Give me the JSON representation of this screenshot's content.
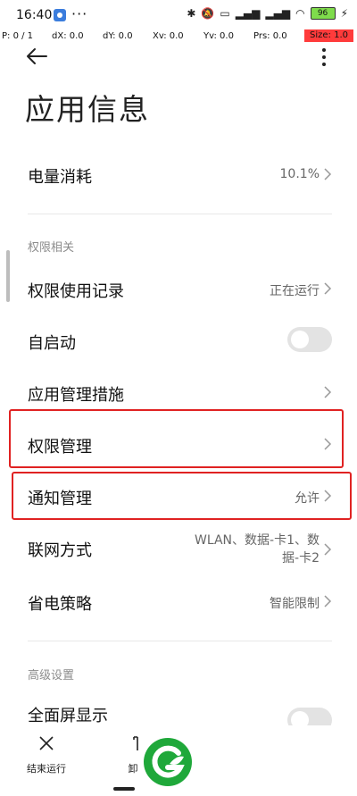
{
  "status_bar": {
    "time": "16:40",
    "more": "···",
    "battery": "96",
    "icons": [
      "bluetooth-icon",
      "mute-icon",
      "laptop-icon",
      "signal-icon",
      "signal-icon",
      "wifi-icon",
      "battery-icon",
      "charging-icon"
    ]
  },
  "debug": {
    "p": "P: 0 / 1",
    "dx": "dX: 0.0",
    "dy": "dY: 0.0",
    "xv": "Xv: 0.0",
    "yv": "Yv: 0.0",
    "prs": "Prs: 0.0",
    "size": "Size: 1.0"
  },
  "header": {
    "title": "应用信息"
  },
  "rows": {
    "battery": {
      "label": "电量消耗",
      "value": "10.1%"
    },
    "permission_records": {
      "label": "权限使用记录",
      "value": "正在运行"
    },
    "autostart": {
      "label": "自启动",
      "enabled": false
    },
    "app_management": {
      "label": "应用管理措施"
    },
    "permission_management": {
      "label": "权限管理"
    },
    "notification_management": {
      "label": "通知管理",
      "value": "允许"
    },
    "network_mode": {
      "label": "联网方式",
      "value_line1": "WLAN、数据-卡1、数",
      "value_line2": "据-卡2"
    },
    "power_saving": {
      "label": "省电策略",
      "value": "智能限制"
    },
    "fullscreen": {
      "label": "全面屏显示",
      "enabled": false
    }
  },
  "sections": {
    "permissions": "权限相关",
    "advanced": "高级设置"
  },
  "bottom_bar": {
    "end_run": "结束运行",
    "uninstall": "卸"
  },
  "colors": {
    "highlight": "#e02222",
    "logo_green": "#1fa83a"
  }
}
